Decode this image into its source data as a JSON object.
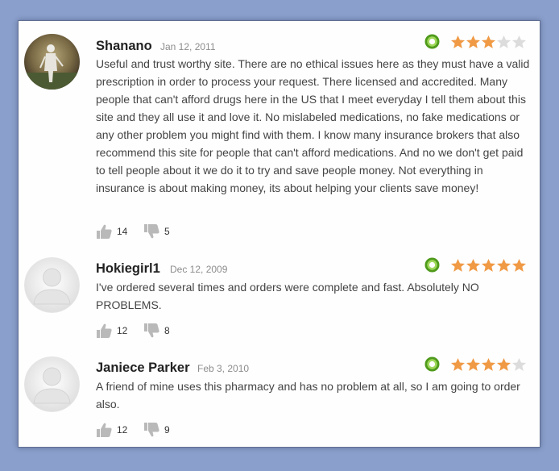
{
  "colors": {
    "star_filled": "#f09a45",
    "star_empty": "#dcdcdc",
    "badge_outer": "#4f9a1c",
    "badge_inner": "#9fd85a",
    "background": "#8a9fcb"
  },
  "reviews": [
    {
      "name": "Shanano",
      "date": "Jan 12, 2011",
      "rating": 3,
      "text": "Useful and trust worthy site. There are no ethical issues here as they must have a valid prescription in order to process your request. There licensed and accredited. Many people that can't afford drugs here in the US that I meet everyday I tell them about this site and they all use it and love it. No mislabeled medications, no fake medications or any other problem you might find with them. I know many insurance brokers that also recommend this site for people that can't afford medications. And no we don't get paid to tell people about it we do it to try and save people money. Not everything in insurance is about making money, its about helping your clients save money!",
      "thumbs_up": "14",
      "thumbs_down": "5",
      "avatar": "user-photo"
    },
    {
      "name": "Hokiegirl1",
      "date": "Dec 12, 2009",
      "rating": 5,
      "text": "I've ordered several times and orders were complete and fast. Absolutely NO PROBLEMS.",
      "thumbs_up": "12",
      "thumbs_down": "8",
      "avatar": "default-avatar"
    },
    {
      "name": "Janiece Parker",
      "date": "Feb 3, 2010",
      "rating": 4,
      "text": "A friend of mine uses this pharmacy and has no problem at all, so I am going to order also.",
      "thumbs_up": "12",
      "thumbs_down": "9",
      "avatar": "default-avatar"
    }
  ]
}
